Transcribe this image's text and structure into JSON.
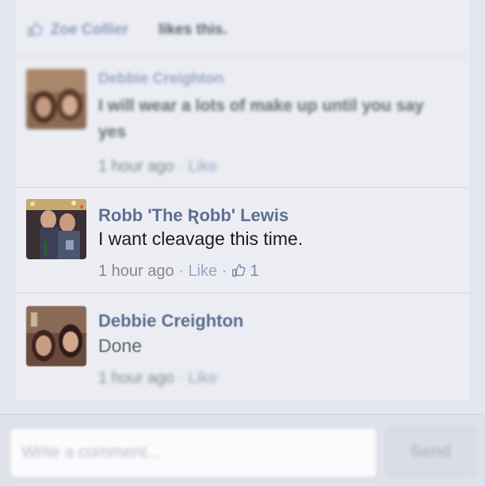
{
  "likes_bar": {
    "liker": "Zoe Collier",
    "text": "likes this."
  },
  "comments": [
    {
      "author": "Debbie Creighton",
      "text": "I will wear a lots of make up until you say yes",
      "time": "1 hour ago",
      "like_label": "Like"
    },
    {
      "author": "Robb 'The Ʀobb' Lewis",
      "text": "I want cleavage this time.",
      "time": "1 hour ago",
      "like_label": "Like",
      "like_count": "1"
    },
    {
      "author": "Debbie Creighton",
      "text": "Done",
      "time": "1 hour ago",
      "like_label": "Like"
    }
  ],
  "composer": {
    "placeholder": "Write a comment...",
    "send_label": "Send"
  },
  "colors": {
    "author_blue": "#5f6f92",
    "link_blue": "#9aa7c6",
    "background": "#e3e6ee"
  },
  "icons": {
    "like": "thumbs-up-icon"
  }
}
